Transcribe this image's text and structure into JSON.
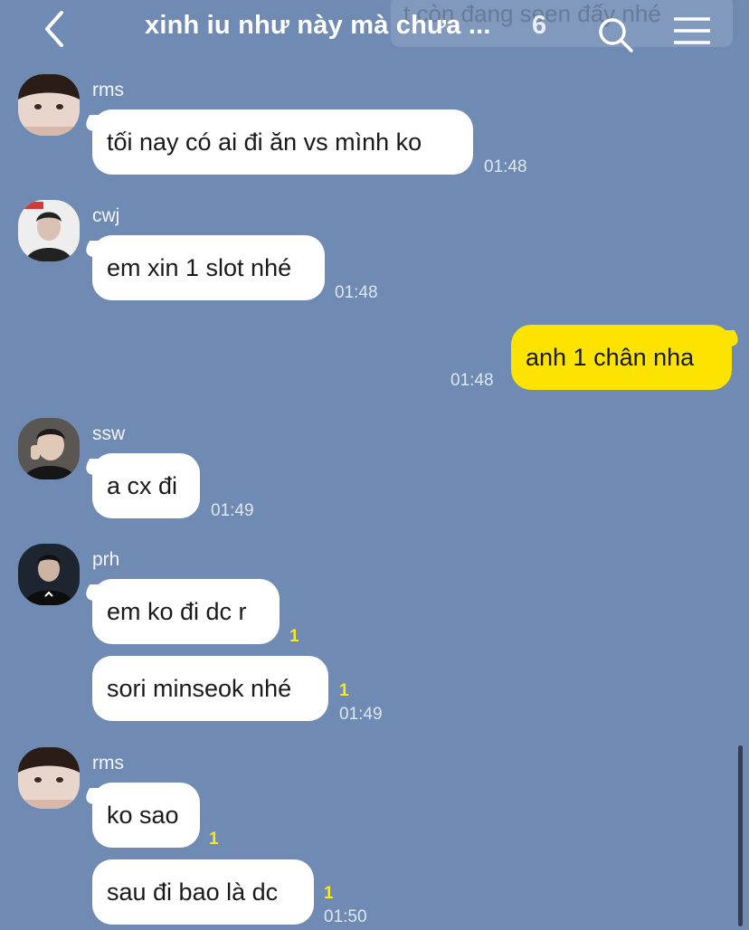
{
  "header": {
    "title": "xinh iu như này mà chưa ...",
    "member_count": "6",
    "ghost_text": "t còn đang seen đấy nhé",
    "back_icon": "chevron-left-icon",
    "search_icon": "search-icon",
    "menu_icon": "hamburger-menu-icon"
  },
  "colors": {
    "background": "#6f8bb3",
    "bubble_other": "#ffffff",
    "bubble_me": "#fce300",
    "unread_count": "#f8e81c"
  },
  "messages": [
    {
      "sender": "rms",
      "text": "tối nay có ai đi ăn vs mình ko",
      "time": "01:48"
    },
    {
      "sender": "cwj",
      "text": "em xin 1 slot nhé",
      "time": "01:48"
    },
    {
      "sender": "me",
      "text": "anh 1 chân nha",
      "time": "01:48"
    },
    {
      "sender": "ssw",
      "text": "a cx đi",
      "time": "01:49"
    },
    {
      "sender": "prh",
      "text": "em ko đi dc r",
      "unread": "1"
    },
    {
      "sender": "prh",
      "text": "sori minseok nhé",
      "unread": "1",
      "time": "01:49"
    },
    {
      "sender": "rms",
      "text": "ko sao",
      "unread": "1"
    },
    {
      "sender": "rms",
      "text": "sau đi bao là dc",
      "unread": "1",
      "time": "01:50"
    }
  ]
}
